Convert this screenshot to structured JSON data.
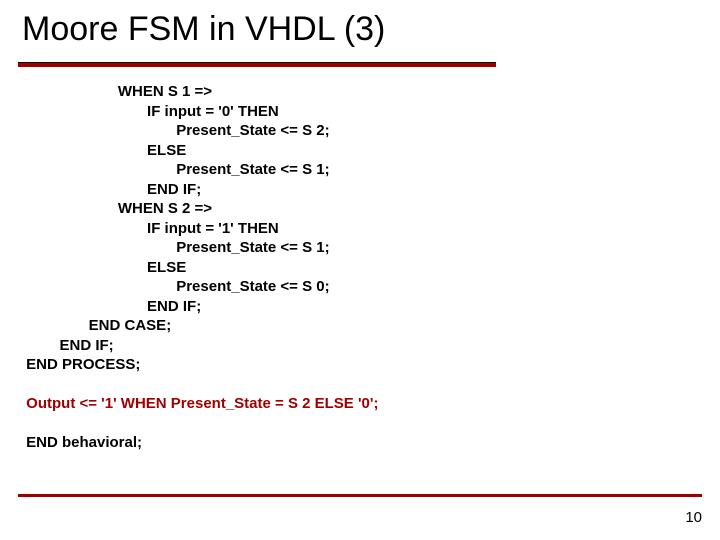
{
  "title": "Moore FSM in VHDL (3)",
  "code_lines": [
    "                       WHEN S 1 =>",
    "                              IF input = '0' THEN",
    "                                     Present_State <= S 2;",
    "                              ELSE",
    "                                     Present_State <= S 1;",
    "                              END IF;",
    "                       WHEN S 2 =>",
    "                              IF input = '1' THEN",
    "                                     Present_State <= S 1;",
    "                              ELSE",
    "                                     Present_State <= S 0;",
    "                              END IF;",
    "                END CASE;",
    "         END IF;",
    " END PROCESS;",
    "",
    " Output <= '1' WHEN Present_State = S 2 ELSE '0';",
    "",
    " END behavioral;"
  ],
  "output_line_index": 16,
  "page_number": "10"
}
